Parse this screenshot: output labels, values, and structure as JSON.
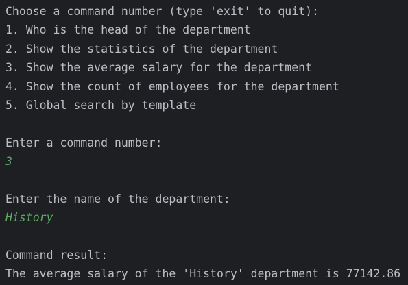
{
  "menu": {
    "prompt": "Choose a command number (type 'exit' to quit):",
    "items": [
      "1. Who is the head of the department",
      "2. Show the statistics of the department",
      "3. Show the average salary for the department",
      "4. Show the count of employees for the department",
      "5. Global search by template"
    ]
  },
  "command_prompt": "Enter a command number:",
  "command_input": "3",
  "department_prompt": "Enter the name of the department:",
  "department_input": "History",
  "result_label": "Command result:",
  "result_text": "The average salary of the 'History' department is 77142.86",
  "colors": {
    "background": "#1e1f22",
    "text": "#bcbec4",
    "user_input": "#5fa866"
  }
}
